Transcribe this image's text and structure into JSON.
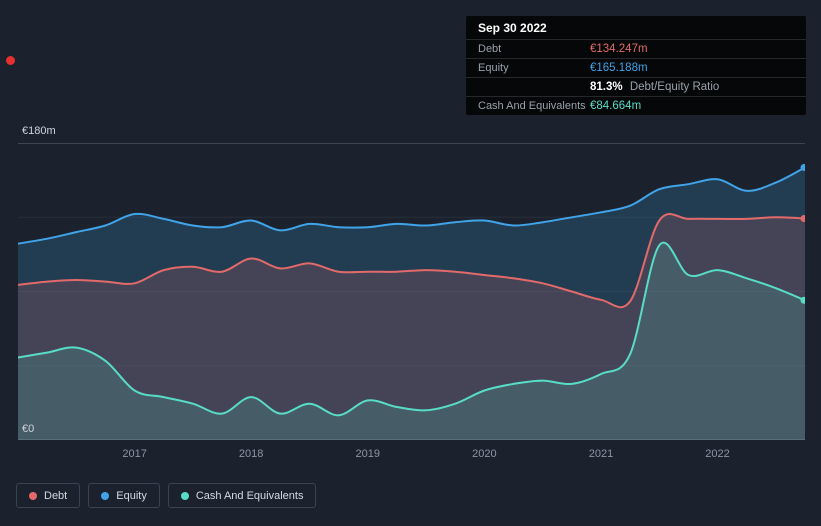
{
  "page": {
    "background": "#1b222d"
  },
  "tooltip": {
    "date": "Sep 30 2022",
    "debt_label": "Debt",
    "debt_value": "€134.247m",
    "equity_label": "Equity",
    "equity_value": "€165.188m",
    "ratio_value": "81.3%",
    "ratio_label": "Debt/Equity Ratio",
    "cash_label": "Cash And Equivalents",
    "cash_value": "€84.664m"
  },
  "axis": {
    "y_top": "€180m",
    "y_bottom": "€0",
    "x_ticks": [
      "2017",
      "2018",
      "2019",
      "2020",
      "2021",
      "2022"
    ]
  },
  "legend": [
    {
      "label": "Debt",
      "color": "#e26a6a"
    },
    {
      "label": "Equity",
      "color": "#41a3e8"
    },
    {
      "label": "Cash And Equivalents",
      "color": "#58dcc6"
    }
  ],
  "chart_data": {
    "type": "area",
    "title": "",
    "xlabel": "",
    "ylabel": "",
    "ylim": [
      0,
      180
    ],
    "x_domain": [
      2016.0,
      2022.75
    ],
    "grid_values": [
      0,
      45,
      90,
      135,
      180
    ],
    "grid": "horizontal",
    "legend_position": "bottom-left",
    "x": [
      2016.0,
      2016.25,
      2016.5,
      2016.75,
      2017.0,
      2017.25,
      2017.5,
      2017.75,
      2018.0,
      2018.25,
      2018.5,
      2018.75,
      2019.0,
      2019.25,
      2019.5,
      2019.75,
      2020.0,
      2020.25,
      2020.5,
      2020.75,
      2021.0,
      2021.25,
      2021.5,
      2021.75,
      2022.0,
      2022.25,
      2022.5,
      2022.75
    ],
    "series": [
      {
        "name": "Debt",
        "color": "#e26a6a",
        "fill": "rgba(225,106,106,0.18)",
        "values": [
          94,
          96,
          97,
          96,
          95,
          103,
          105,
          102,
          110,
          104,
          107,
          102,
          102,
          102,
          103,
          102,
          100,
          98,
          95,
          90,
          85,
          84,
          133,
          134,
          134,
          134,
          135,
          134.247
        ]
      },
      {
        "name": "Equity",
        "color": "#41a3e8",
        "fill": "rgba(65,163,232,0.20)",
        "values": [
          119,
          122,
          126,
          130,
          137,
          134,
          130,
          129,
          133,
          127,
          131,
          129,
          129,
          131,
          130,
          132,
          133,
          130,
          132,
          135,
          138,
          142,
          152,
          155,
          158,
          151,
          156,
          165.188
        ]
      },
      {
        "name": "Cash And Equivalents",
        "color": "#58dcc6",
        "fill": "rgba(83,217,193,0.16)",
        "values": [
          50,
          53,
          56,
          48,
          30,
          26,
          22,
          16,
          26,
          16,
          22,
          15,
          24,
          20,
          18,
          22,
          30,
          34,
          36,
          34,
          40,
          52,
          118,
          100,
          103,
          98,
          92,
          84.664
        ]
      }
    ],
    "draw_order": [
      1,
      0,
      2
    ]
  }
}
